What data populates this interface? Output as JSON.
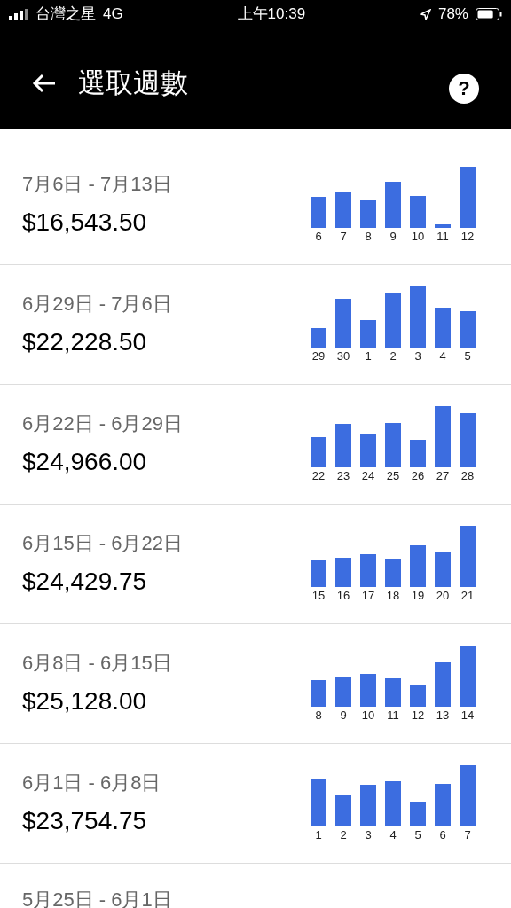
{
  "status_bar": {
    "carrier": "台灣之星",
    "network": "4G",
    "time": "上午10:39",
    "battery": "78%"
  },
  "header": {
    "title": "選取週數",
    "help": "?"
  },
  "weeks": [
    {
      "range": "7月6日 - 7月13日",
      "amount": "$16,543.50",
      "days": [
        {
          "label": "6",
          "level": 0.5
        },
        {
          "label": "7",
          "level": 0.59
        },
        {
          "label": "8",
          "level": 0.46
        },
        {
          "label": "9",
          "level": 0.74
        },
        {
          "label": "10",
          "level": 0.51
        },
        {
          "label": "11",
          "level": 0.06
        },
        {
          "label": "12",
          "level": 0.99
        }
      ]
    },
    {
      "range": "6月29日 - 7月6日",
      "amount": "$22,228.50",
      "days": [
        {
          "label": "29",
          "level": 0.31
        },
        {
          "label": "30",
          "level": 0.79
        },
        {
          "label": "1",
          "level": 0.44
        },
        {
          "label": "2",
          "level": 0.89
        },
        {
          "label": "3",
          "level": 0.99
        },
        {
          "label": "4",
          "level": 0.64
        },
        {
          "label": "5",
          "level": 0.59
        }
      ]
    },
    {
      "range": "6月22日 - 6月29日",
      "amount": "$24,966.00",
      "days": [
        {
          "label": "22",
          "level": 0.49
        },
        {
          "label": "23",
          "level": 0.7
        },
        {
          "label": "24",
          "level": 0.53
        },
        {
          "label": "25",
          "level": 0.71
        },
        {
          "label": "26",
          "level": 0.44
        },
        {
          "label": "27",
          "level": 0.99
        },
        {
          "label": "28",
          "level": 0.87
        }
      ]
    },
    {
      "range": "6月15日 - 6月22日",
      "amount": "$24,429.75",
      "days": [
        {
          "label": "15",
          "level": 0.44
        },
        {
          "label": "16",
          "level": 0.47
        },
        {
          "label": "17",
          "level": 0.53
        },
        {
          "label": "18",
          "level": 0.46
        },
        {
          "label": "19",
          "level": 0.67
        },
        {
          "label": "20",
          "level": 0.56
        },
        {
          "label": "21",
          "level": 0.99
        }
      ]
    },
    {
      "range": "6月8日 - 6月15日",
      "amount": "$25,128.00",
      "days": [
        {
          "label": "8",
          "level": 0.43
        },
        {
          "label": "9",
          "level": 0.49
        },
        {
          "label": "10",
          "level": 0.53
        },
        {
          "label": "11",
          "level": 0.46
        },
        {
          "label": "12",
          "level": 0.34
        },
        {
          "label": "13",
          "level": 0.71
        },
        {
          "label": "14",
          "level": 0.99
        }
      ]
    },
    {
      "range": "6月1日 - 6月8日",
      "amount": "$23,754.75",
      "days": [
        {
          "label": "1",
          "level": 0.76
        },
        {
          "label": "2",
          "level": 0.5
        },
        {
          "label": "3",
          "level": 0.67
        },
        {
          "label": "4",
          "level": 0.73
        },
        {
          "label": "5",
          "level": 0.39
        },
        {
          "label": "6",
          "level": 0.69
        },
        {
          "label": "7",
          "level": 0.99
        }
      ]
    },
    {
      "range": "5月25日 - 6月1日"
    }
  ]
}
